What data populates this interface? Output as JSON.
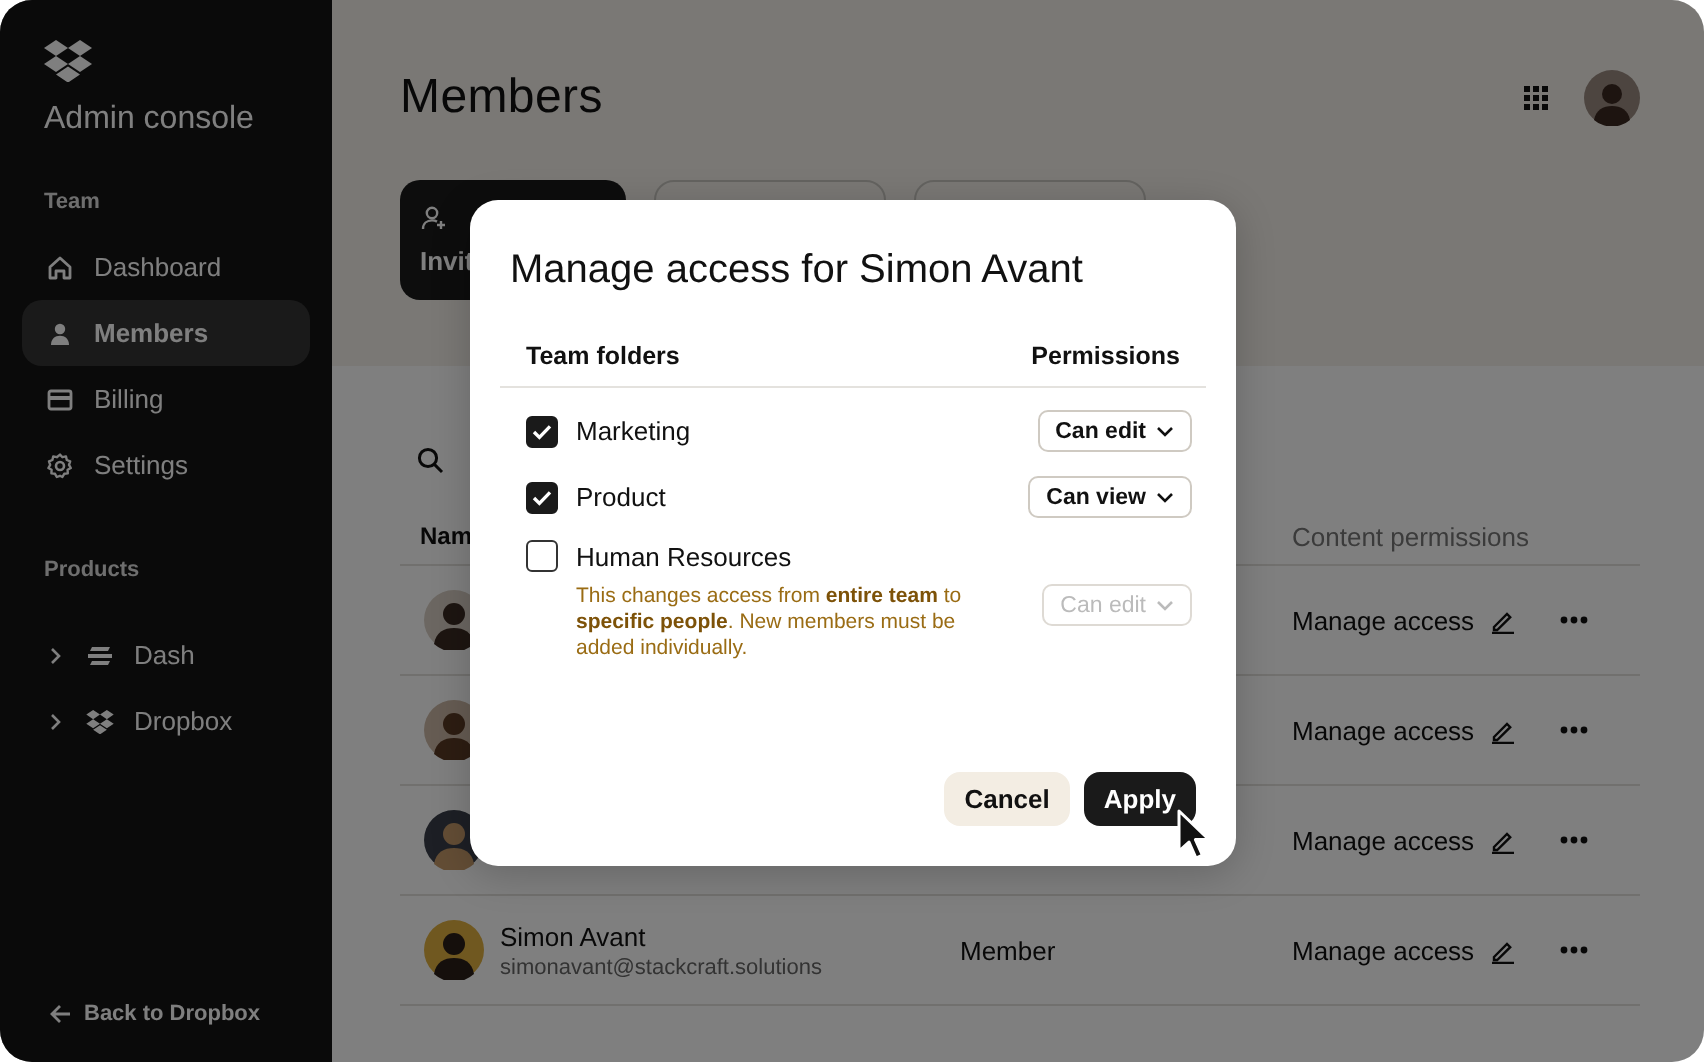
{
  "sidebar": {
    "title": "Admin console",
    "sections": [
      {
        "heading": "Team",
        "items": [
          {
            "label": "Dashboard",
            "selected": false
          },
          {
            "label": "Members",
            "selected": true
          },
          {
            "label": "Billing",
            "selected": false
          },
          {
            "label": "Settings",
            "selected": false
          }
        ]
      },
      {
        "heading": "Products",
        "items": [
          {
            "label": "Dash",
            "expanded": false
          },
          {
            "label": "Dropbox",
            "expanded": false
          }
        ]
      }
    ],
    "back_link": "Back to Dropbox"
  },
  "main": {
    "title": "Members",
    "invite_button": "Invit",
    "table": {
      "columns": [
        "Nam",
        "Content permissions"
      ],
      "rows": [
        {
          "action": "Manage access"
        },
        {
          "action": "Manage access"
        },
        {
          "action": "Manage access"
        },
        {
          "name": "Simon Avant",
          "email": "simonavant@stackcraft.solutions",
          "role": "Member",
          "action": "Manage access"
        }
      ]
    }
  },
  "dialog": {
    "title": "Manage access for Simon Avant",
    "columns": [
      "Team folders",
      "Permissions"
    ],
    "folders": [
      {
        "name": "Marketing",
        "checked": true,
        "permission": "Can edit",
        "disabled": false
      },
      {
        "name": "Product",
        "checked": true,
        "permission": "Can view",
        "disabled": false
      },
      {
        "name": "Human Resources",
        "checked": false,
        "permission": "Can edit",
        "disabled": true,
        "note": "This changes access from **entire team** to **specific people**. New members must be added individually."
      }
    ],
    "buttons": [
      {
        "label": "Cancel",
        "kind": "secondary"
      },
      {
        "label": "Apply",
        "kind": "primary"
      }
    ]
  }
}
